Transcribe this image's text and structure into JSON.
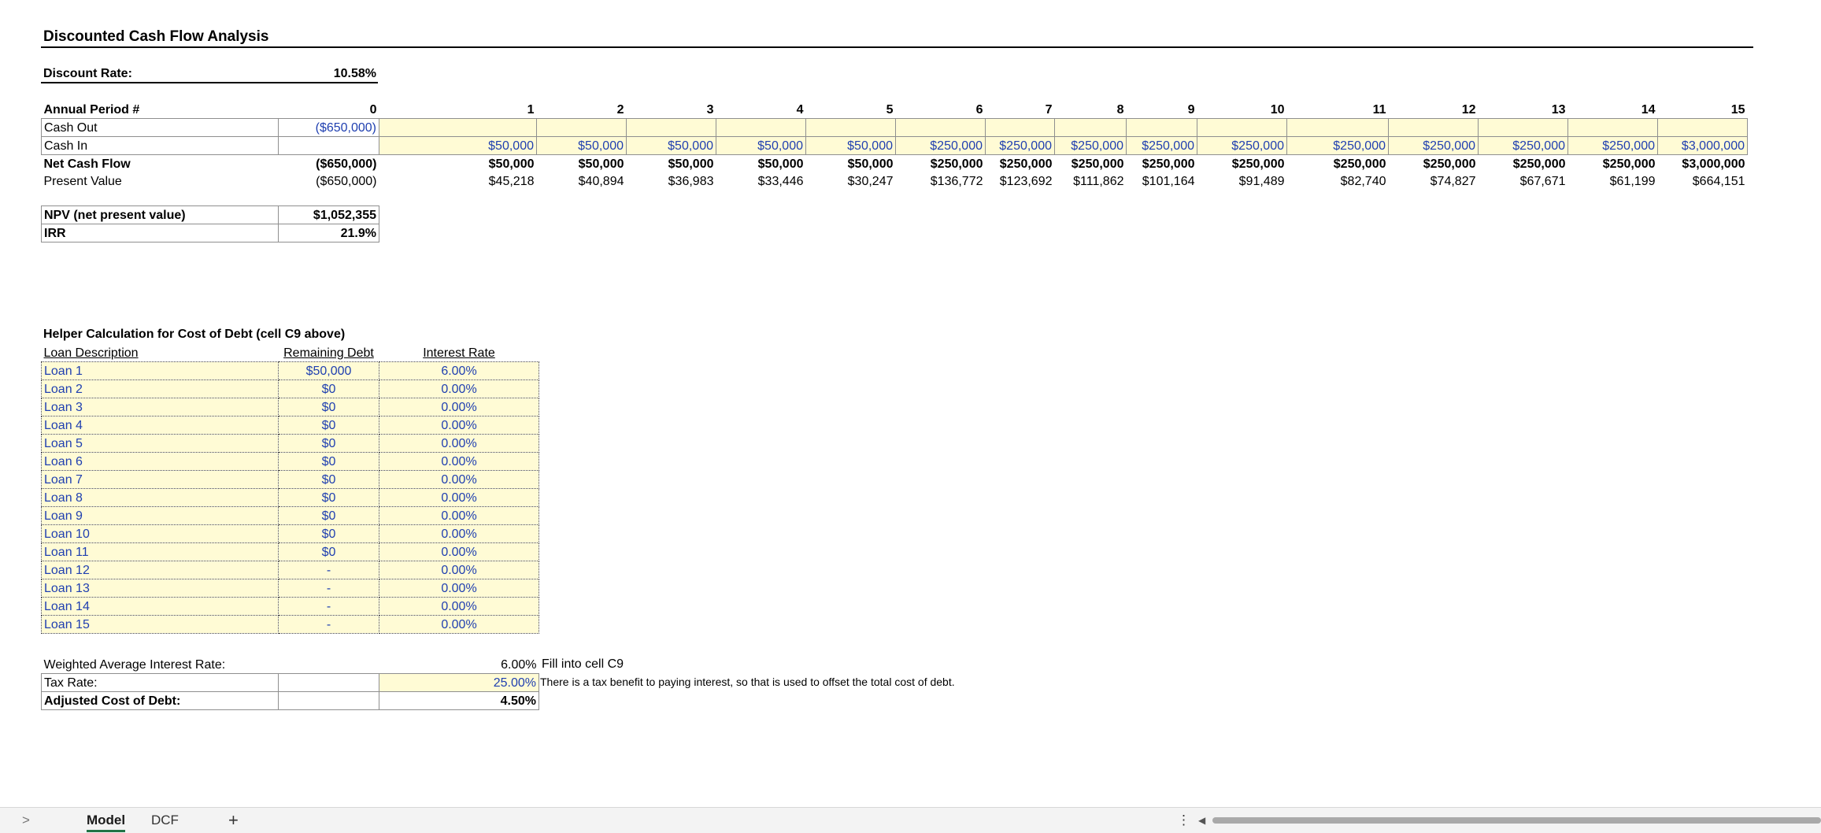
{
  "sheet": {
    "title": "Discounted Cash Flow Analysis",
    "discount_rate_label": "Discount Rate:",
    "discount_rate_value": "10.58%"
  },
  "dcf": {
    "period_label": "Annual Period #",
    "periods": [
      "0",
      "1",
      "2",
      "3",
      "4",
      "5",
      "6",
      "7",
      "8",
      "9",
      "10",
      "11",
      "12",
      "13",
      "14",
      "15"
    ],
    "rows": [
      {
        "label": "Cash Out",
        "style": "input",
        "values": [
          "($650,000)",
          "",
          "",
          "",
          "",
          "",
          "",
          "",
          "",
          "",
          "",
          "",
          "",
          "",
          "",
          ""
        ]
      },
      {
        "label": "Cash In",
        "style": "input",
        "values": [
          "",
          "$50,000",
          "$50,000",
          "$50,000",
          "$50,000",
          "$50,000",
          "$250,000",
          "$250,000",
          "$250,000",
          "$250,000",
          "$250,000",
          "$250,000",
          "$250,000",
          "$250,000",
          "$250,000",
          "$3,000,000"
        ]
      },
      {
        "label": "Net Cash Flow",
        "style": "bold",
        "values": [
          "($650,000)",
          "$50,000",
          "$50,000",
          "$50,000",
          "$50,000",
          "$50,000",
          "$250,000",
          "$250,000",
          "$250,000",
          "$250,000",
          "$250,000",
          "$250,000",
          "$250,000",
          "$250,000",
          "$250,000",
          "$3,000,000"
        ]
      },
      {
        "label": "Present Value",
        "style": "plain",
        "values": [
          "($650,000)",
          "$45,218",
          "$40,894",
          "$36,983",
          "$33,446",
          "$30,247",
          "$136,772",
          "$123,692",
          "$111,862",
          "$101,164",
          "$91,489",
          "$82,740",
          "$74,827",
          "$67,671",
          "$61,199",
          "$664,151"
        ]
      }
    ]
  },
  "summary": {
    "npv_label": "NPV (net present value)",
    "npv_value": "$1,052,355",
    "irr_label": "IRR",
    "irr_value": "21.9%"
  },
  "helper": {
    "title": "Helper Calculation for Cost of Debt (cell C9 above)",
    "headers": [
      "Loan Description",
      "Remaining Debt",
      "Interest Rate"
    ],
    "loans": [
      {
        "name": "Loan 1",
        "debt": "$50,000",
        "rate": "6.00%"
      },
      {
        "name": "Loan 2",
        "debt": "$0",
        "rate": "0.00%"
      },
      {
        "name": "Loan 3",
        "debt": "$0",
        "rate": "0.00%"
      },
      {
        "name": "Loan 4",
        "debt": "$0",
        "rate": "0.00%"
      },
      {
        "name": "Loan 5",
        "debt": "$0",
        "rate": "0.00%"
      },
      {
        "name": "Loan 6",
        "debt": "$0",
        "rate": "0.00%"
      },
      {
        "name": "Loan 7",
        "debt": "$0",
        "rate": "0.00%"
      },
      {
        "name": "Loan 8",
        "debt": "$0",
        "rate": "0.00%"
      },
      {
        "name": "Loan 9",
        "debt": "$0",
        "rate": "0.00%"
      },
      {
        "name": "Loan 10",
        "debt": "$0",
        "rate": "0.00%"
      },
      {
        "name": "Loan 11",
        "debt": "$0",
        "rate": "0.00%"
      },
      {
        "name": "Loan 12",
        "debt": "-",
        "rate": "0.00%"
      },
      {
        "name": "Loan 13",
        "debt": "-",
        "rate": "0.00%"
      },
      {
        "name": "Loan 14",
        "debt": "-",
        "rate": "0.00%"
      },
      {
        "name": "Loan 15",
        "debt": "-",
        "rate": "0.00%"
      }
    ]
  },
  "cost_of_debt": {
    "wair_label": "Weighted Average Interest Rate:",
    "wair_value": "6.00%",
    "wair_note": "Fill into cell C9",
    "tax_label": "Tax Rate:",
    "tax_value": "25.00%",
    "tax_note": "There is a tax benefit to paying interest, so that is used to offset the total cost of debt.",
    "adj_label": "Adjusted Cost of Debt:",
    "adj_value": "4.50%"
  },
  "tabs": {
    "nav_glyph": ">",
    "sheets": [
      "Model",
      "DCF"
    ],
    "active": "Model",
    "add_glyph": "+",
    "options_glyph": "⋮",
    "scroll_left_glyph": "◀"
  }
}
